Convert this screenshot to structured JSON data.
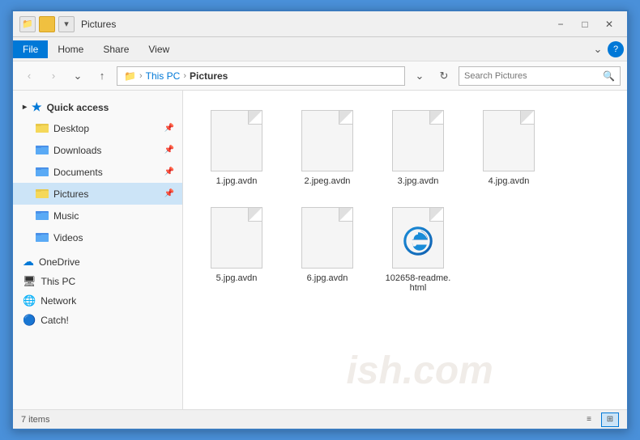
{
  "titlebar": {
    "title": "Pictures",
    "minimize_label": "−",
    "maximize_label": "□",
    "close_label": "✕"
  },
  "menubar": {
    "items": [
      {
        "label": "File",
        "active": true
      },
      {
        "label": "Home",
        "active": false
      },
      {
        "label": "Share",
        "active": false
      },
      {
        "label": "View",
        "active": false
      }
    ]
  },
  "addressbar": {
    "back_label": "‹",
    "forward_label": "›",
    "up_label": "↑",
    "path_parts": [
      "This PC",
      "Pictures"
    ],
    "search_placeholder": "Search Pictures",
    "search_icon": "🔍"
  },
  "sidebar": {
    "quick_access_label": "Quick access",
    "items": [
      {
        "label": "Desktop",
        "pinned": true,
        "icon": "folder_yellow"
      },
      {
        "label": "Downloads",
        "pinned": true,
        "icon": "folder_yellow"
      },
      {
        "label": "Documents",
        "pinned": true,
        "icon": "folder_yellow"
      },
      {
        "label": "Pictures",
        "pinned": true,
        "icon": "folder_yellow",
        "active": true
      },
      {
        "label": "Music",
        "pinned": false,
        "icon": "folder_music"
      },
      {
        "label": "Videos",
        "pinned": false,
        "icon": "folder_video"
      }
    ],
    "onedrive_label": "OneDrive",
    "thispc_label": "This PC",
    "network_label": "Network",
    "catch_label": "Catch!"
  },
  "files": [
    {
      "name": "1.jpg.avdn",
      "type": "generic"
    },
    {
      "name": "2.jpeg.avdn",
      "type": "generic"
    },
    {
      "name": "3.jpg.avdn",
      "type": "generic"
    },
    {
      "name": "4.jpg.avdn",
      "type": "generic"
    },
    {
      "name": "5.jpg.avdn",
      "type": "generic"
    },
    {
      "name": "6.jpg.avdn",
      "type": "generic"
    },
    {
      "name": "102658-readme.\nhtml",
      "type": "html"
    }
  ],
  "statusbar": {
    "item_count": "7 items"
  },
  "watermark": {
    "text": "ish.com"
  }
}
